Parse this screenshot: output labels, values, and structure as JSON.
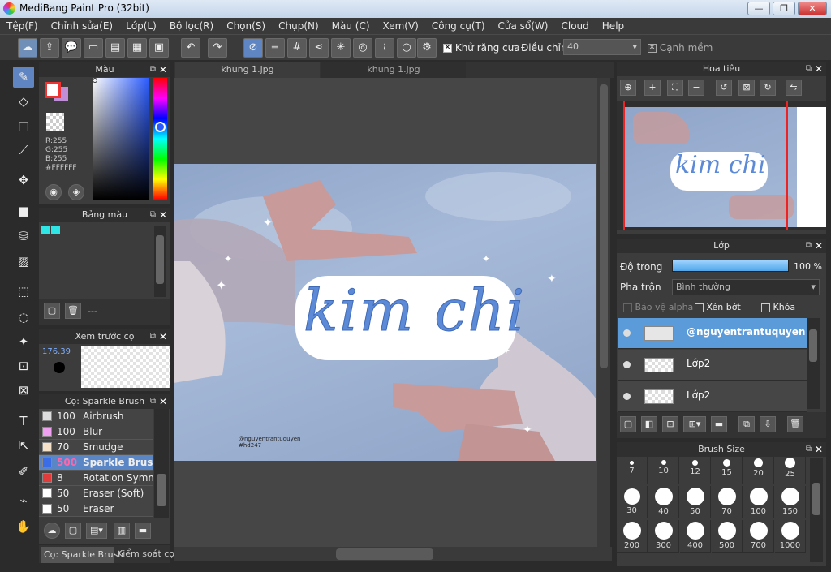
{
  "window": {
    "title": "MediBang Paint Pro (32bit)"
  },
  "menu": [
    "Tệp(F)",
    "Chỉnh sửa(E)",
    "Lớp(L)",
    "Bộ lọc(R)",
    "Chọn(S)",
    "Chụp(N)",
    "Màu (C)",
    "Xem(V)",
    "Công cụ(T)",
    "Cửa sổ(W)",
    "Cloud",
    "Help"
  ],
  "toolbar": {
    "antialias_label": "Khử răng cưa",
    "adjust_label": "Điều chỉnh",
    "adjust_value": "40",
    "edge_label": "Cạnh mềm"
  },
  "color_panel": {
    "title": "Màu",
    "r": "R:255",
    "g": "G:255",
    "b": "B:255",
    "hex": "#FFFFFF",
    "primary": "#ffffff",
    "secondary": "#c08ed6"
  },
  "palette_panel": {
    "title": "Bảng màu",
    "swatches": [
      "#2ee6e6",
      "#2ee6e6"
    ],
    "footer": "---"
  },
  "preview_panel": {
    "title": "Xem trước cọ",
    "size": "176.39"
  },
  "brush_panel": {
    "title": "Cọ: Sparkle Brush",
    "brushes": [
      {
        "size": "100",
        "name": "Airbrush",
        "color": "#dddddd"
      },
      {
        "size": "100",
        "name": "Blur",
        "color": "#f0a0f0"
      },
      {
        "size": "70",
        "name": "Smudge",
        "color": "#f5e1c8"
      },
      {
        "size": "500",
        "name": "Sparkle Brush",
        "color": "#3b6ee6"
      },
      {
        "size": "8",
        "name": "Rotation Symmetry",
        "color": "#e23b3b"
      },
      {
        "size": "50",
        "name": "Eraser (Soft)",
        "color": "#ffffff"
      },
      {
        "size": "50",
        "name": "Eraser",
        "color": "#ffffff"
      }
    ],
    "tabs": [
      "Cọ: Sparkle Brush",
      "Kiểm soát cọ"
    ]
  },
  "tabs": [
    "khung 1.jpg",
    "khung 1.jpg"
  ],
  "canvas": {
    "text": "kim chi",
    "watermark": "@nguyentrantuquyen",
    "watermark2": "#hd247"
  },
  "navigator": {
    "title": "Hoa tiêu"
  },
  "layer_panel": {
    "title": "Lớp",
    "opacity_label": "Độ trong",
    "opacity_value": "100 %",
    "opacity_fraction": 1.0,
    "blend_label": "Pha trộn",
    "blend_value": "Bình thường",
    "protect_alpha": "Bảo vệ alpha",
    "clipping": "Xén bớt",
    "lock": "Khóa",
    "layers": [
      {
        "name": "@nguyentrantuquyen",
        "selected": true
      },
      {
        "name": "Lớp2",
        "selected": false
      },
      {
        "name": "Lớp2",
        "selected": false
      }
    ]
  },
  "brush_size_panel": {
    "title": "Brush Size",
    "sizes": [
      "7",
      "10",
      "12",
      "15",
      "20",
      "25",
      "30",
      "40",
      "50",
      "70",
      "100",
      "150",
      "200",
      "300",
      "400",
      "500",
      "700",
      "1000"
    ]
  }
}
